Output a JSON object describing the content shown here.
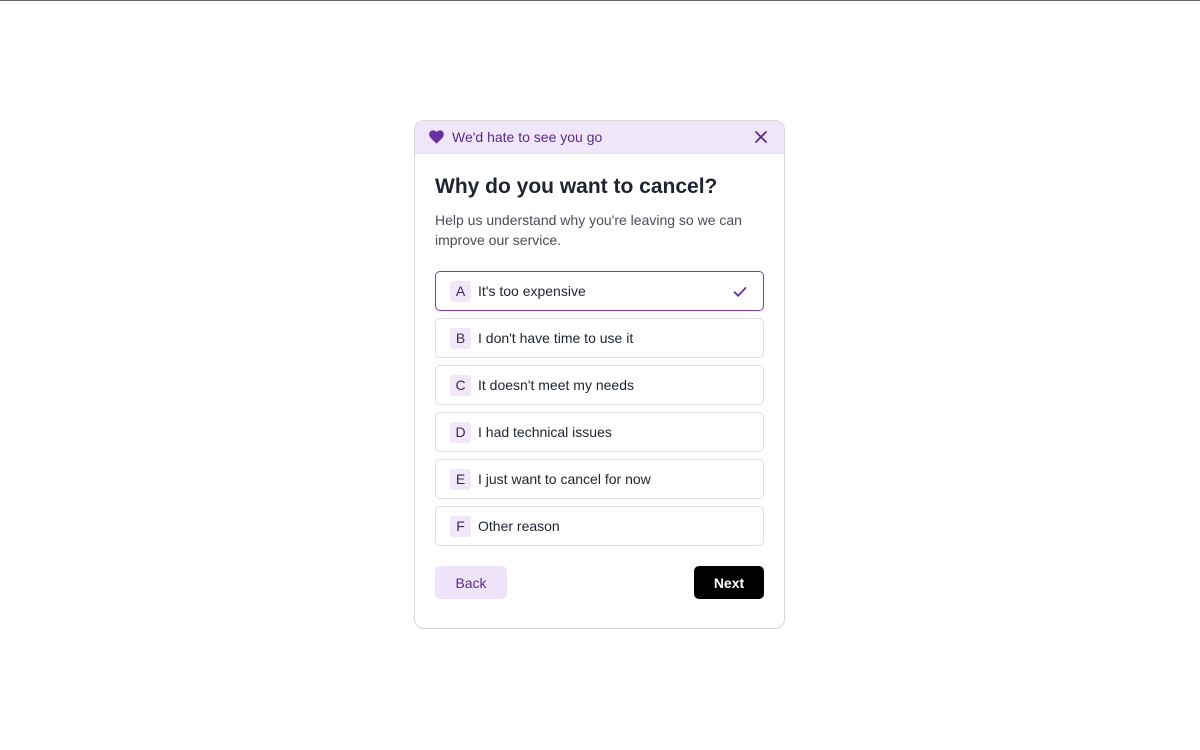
{
  "banner": {
    "icon": "heart-icon",
    "text": "We'd hate to see you go",
    "close_icon": "close-icon"
  },
  "question": {
    "title": "Why do you want to cancel?",
    "subtitle": "Help us understand why you're leaving so we can improve our service."
  },
  "options": [
    {
      "key": "A",
      "label": "It's too expensive",
      "selected": true
    },
    {
      "key": "B",
      "label": "I don't have time to use it",
      "selected": false
    },
    {
      "key": "C",
      "label": "It doesn't meet my needs",
      "selected": false
    },
    {
      "key": "D",
      "label": "I had technical issues",
      "selected": false
    },
    {
      "key": "E",
      "label": "I just want to cancel for now",
      "selected": false
    },
    {
      "key": "F",
      "label": "Other reason",
      "selected": false
    }
  ],
  "footer": {
    "back_label": "Back",
    "next_label": "Next"
  },
  "colors": {
    "accent": "#6a2fa3",
    "banner_bg": "#f0e6f9",
    "primary_button": "#000000"
  }
}
